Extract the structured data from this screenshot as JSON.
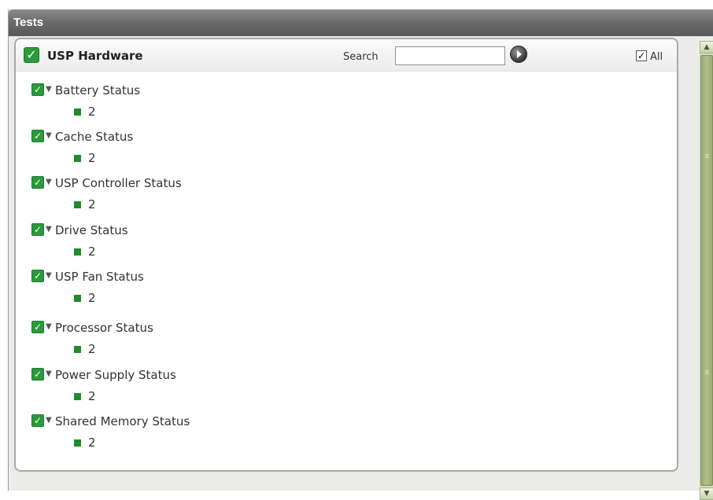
{
  "window": {
    "title": "Tests"
  },
  "panel": {
    "title": "USP Hardware",
    "search_label": "Search",
    "search_value": "",
    "all_label": "All",
    "all_checked": true
  },
  "tests": [
    {
      "name": "Battery Status",
      "value": "2"
    },
    {
      "name": "Cache Status",
      "value": "2"
    },
    {
      "name": "USP Controller Status",
      "value": "2"
    },
    {
      "name": "Drive Status",
      "value": "2"
    },
    {
      "name": "USP Fan Status",
      "value": "2"
    },
    {
      "name": "Processor Status",
      "value": "2"
    },
    {
      "name": "Power Supply Status",
      "value": "2"
    },
    {
      "name": "Shared Memory Status",
      "value": "2"
    }
  ],
  "colors": {
    "check_green": "#2a9a3a",
    "scroll_green": "#aebf88"
  }
}
